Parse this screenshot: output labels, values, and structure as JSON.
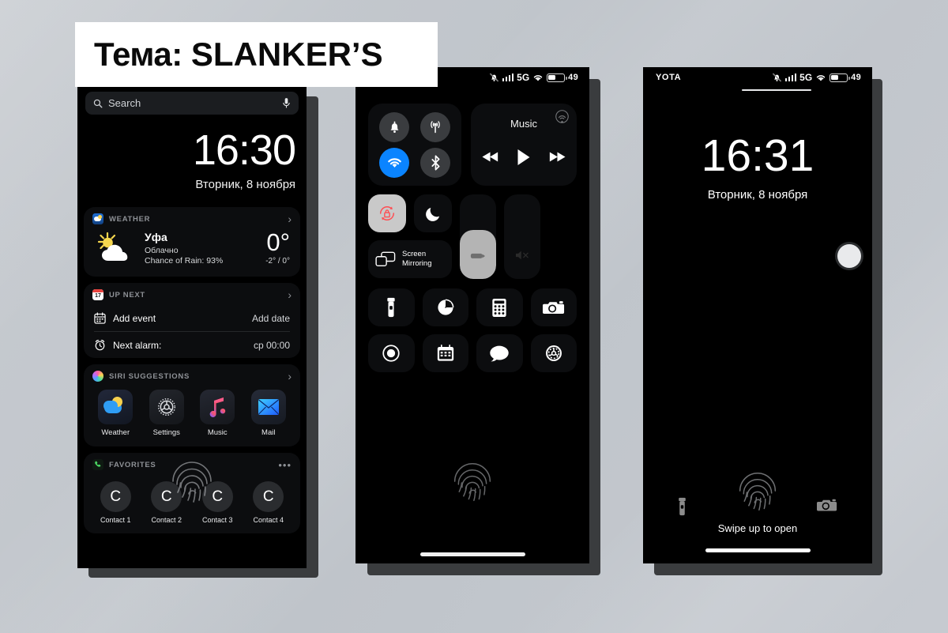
{
  "banner": {
    "prefix": "Тема:",
    "name": "SLANKER’S"
  },
  "phone1": {
    "name": "today-view",
    "search": {
      "placeholder": "Search",
      "icon": "search-icon",
      "mic_icon": "microphone-icon"
    },
    "clock": {
      "time": "16:30",
      "date": "Вторник, 8 ноября"
    },
    "weather_card": {
      "header": "WEATHER",
      "city": "Уфа",
      "condition": "Облачно",
      "rain": "Chance of Rain: 93%",
      "temp": "0°",
      "range": "-2° / 0°",
      "icon": "sun-behind-cloud-icon",
      "chevron": "›"
    },
    "upnext_card": {
      "header": "UP NEXT",
      "badge_day": "17",
      "rows": [
        {
          "icon": "calendar-icon",
          "label": "Add event",
          "value": "Add date"
        },
        {
          "icon": "alarm-clock-icon",
          "label": "Next alarm:",
          "value": "ср 00:00"
        }
      ],
      "chevron": "›"
    },
    "siri_card": {
      "header": "SIRI SUGGESTIONS",
      "chevron": "›",
      "apps": [
        {
          "name": "Weather",
          "icon": "weather-app-icon"
        },
        {
          "name": "Settings",
          "icon": "settings-gear-icon"
        },
        {
          "name": "Music",
          "icon": "music-note-icon"
        },
        {
          "name": "Mail",
          "icon": "mail-envelope-icon"
        }
      ]
    },
    "favorites_card": {
      "header": "FAVORITES",
      "more": "•••",
      "contacts": [
        {
          "initial": "C",
          "name": "Contact 1"
        },
        {
          "initial": "C",
          "name": "Contact 2"
        },
        {
          "initial": "C",
          "name": "Contact 3"
        },
        {
          "initial": "C",
          "name": "Contact 4"
        }
      ]
    }
  },
  "phone2": {
    "name": "control-center",
    "statusbar": {
      "carrier": "",
      "network": "5G",
      "battery_pct": "49",
      "mute_icon": "bell-slash-icon",
      "wifi_icon": "wifi-icon",
      "battery_icon": "battery-icon"
    },
    "connectivity": [
      {
        "icon": "bell-icon",
        "label": "Ringer",
        "active": false
      },
      {
        "icon": "cellular-antenna-icon",
        "label": "Cellular Data",
        "active": false
      },
      {
        "icon": "wifi-icon",
        "label": "Wi-Fi",
        "active": true
      },
      {
        "icon": "bluetooth-icon",
        "label": "Bluetooth",
        "active": false
      }
    ],
    "music": {
      "title": "Music",
      "airplay_icon": "airplay-audio-icon",
      "controls": [
        {
          "icon": "rewind-icon",
          "label": "Previous"
        },
        {
          "icon": "play-icon",
          "label": "Play"
        },
        {
          "icon": "fast-forward-icon",
          "label": "Next"
        }
      ]
    },
    "toggles": [
      {
        "icon": "rotation-lock-icon",
        "label": "Rotation Lock",
        "active": true
      },
      {
        "icon": "moon-icon",
        "label": "Do Not Disturb",
        "active": false
      }
    ],
    "screen_mirroring": {
      "label_line1": "Screen",
      "label_line2": "Mirroring",
      "icon": "screen-mirroring-icon"
    },
    "brightness": {
      "label": "Brightness",
      "level_pct": 58,
      "icon": "brightness-icon"
    },
    "volume": {
      "label": "Volume",
      "level_pct": 0,
      "icon": "speaker-mute-icon"
    },
    "tiles": [
      {
        "icon": "flashlight-icon",
        "label": "Flashlight"
      },
      {
        "icon": "timer-icon",
        "label": "Timer"
      },
      {
        "icon": "calculator-icon",
        "label": "Calculator"
      },
      {
        "icon": "camera-icon",
        "label": "Camera"
      },
      {
        "icon": "screen-record-icon",
        "label": "Screen Recording"
      },
      {
        "icon": "calendar-icon",
        "label": "Calendar"
      },
      {
        "icon": "messages-bubble-icon",
        "label": "Messages"
      },
      {
        "icon": "settings-gear-icon",
        "label": "Settings"
      }
    ],
    "fingerprint_icon": "fingerprint-icon"
  },
  "phone3": {
    "name": "lock-screen",
    "statusbar": {
      "carrier": "YOTA",
      "network": "5G",
      "battery_pct": "49",
      "mute_icon": "bell-slash-icon",
      "wifi_icon": "wifi-icon",
      "battery_icon": "battery-icon"
    },
    "clock": {
      "time": "16:31",
      "date": "Вторник, 8 ноября"
    },
    "side_button": {
      "icon": "side-button-icon"
    },
    "fingerprint_icon": "fingerprint-icon",
    "hint": "Swipe up to open",
    "actions": [
      {
        "icon": "flashlight-icon",
        "label": "Flashlight"
      },
      {
        "icon": "camera-icon",
        "label": "Camera"
      }
    ]
  },
  "colors": {
    "accent_blue": "#0a84ff",
    "rotation_red": "#ff4d52",
    "background": "#c2c6cb",
    "card": "#0c0d0f"
  }
}
